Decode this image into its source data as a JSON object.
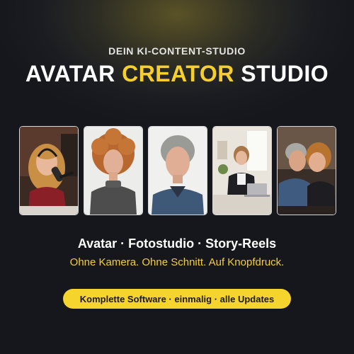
{
  "header": {
    "eyebrow": "DEIN KI-CONTENT-STUDIO",
    "title_part1": "AVATAR",
    "title_part2": "CREATOR",
    "title_part3": "STUDIO"
  },
  "features": {
    "subtitle": "Avatar · Fotostudio · Story-Reels",
    "tagline": "Ohne Kamera. Ohne Schnitt. Auf Knopfdruck."
  },
  "cta": {
    "label": "Komplette Software · einmalig · alle Updates"
  },
  "colors": {
    "accent": "#f6cf2f",
    "button": "#f6d42e",
    "background": "#1a1c22"
  }
}
